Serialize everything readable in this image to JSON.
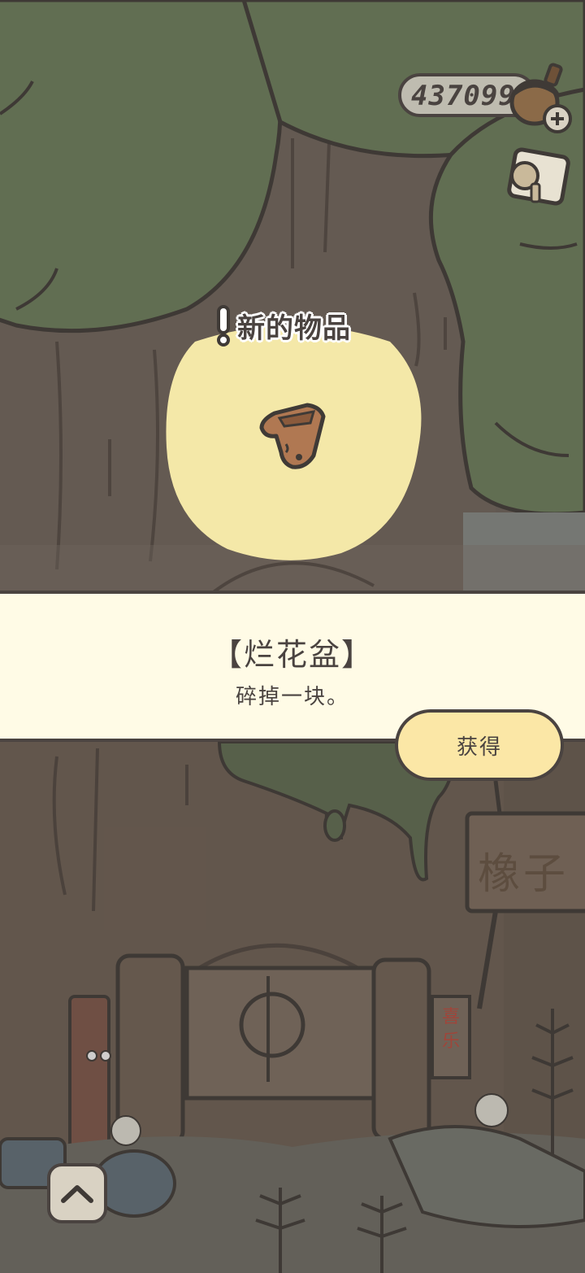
{
  "hud": {
    "acorn_count": "437099",
    "currency_icon": "acorn-icon",
    "menu_icon": "note-icon"
  },
  "new_item": {
    "title": "新的物品",
    "icon": "broken-flowerpot-icon"
  },
  "item_info": {
    "name": "【烂花盆】",
    "description": "碎掉一块。"
  },
  "actions": {
    "obtain_label": "获得",
    "expand_icon": "chevron-up-icon"
  },
  "scene": {
    "shop_sign": "橡子",
    "door_banner": "喜乐"
  },
  "colors": {
    "outline": "#4a4340",
    "panel_bg": "#fffbe6",
    "button_bg": "#fbe7a6",
    "glow": "#f3e6a6",
    "foliage": "#6a7a5a"
  }
}
